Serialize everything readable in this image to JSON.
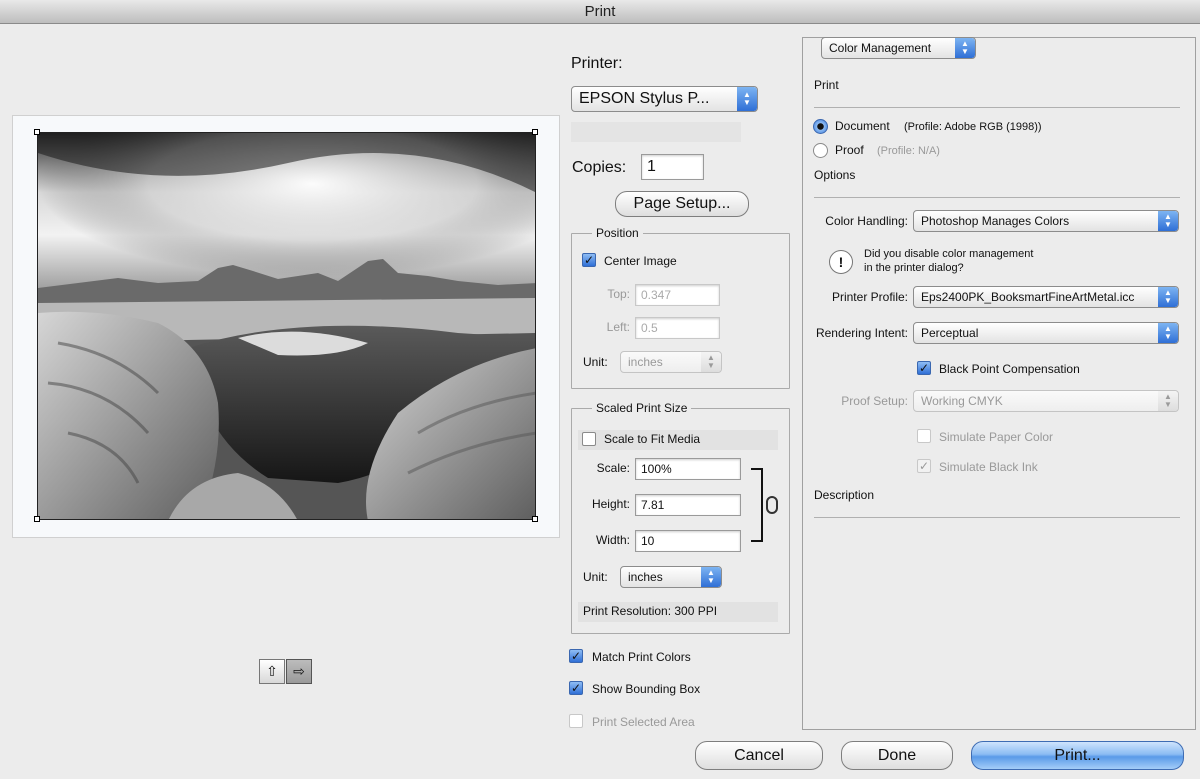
{
  "window": {
    "title": "Print"
  },
  "printer": {
    "label": "Printer:",
    "selected": "EPSON Stylus P...",
    "copies_label": "Copies:",
    "copies_value": "1",
    "page_setup_label": "Page Setup..."
  },
  "position": {
    "group_label": "Position",
    "center_image_label": "Center Image",
    "center_image_checked": true,
    "top_label": "Top:",
    "top_value": "0.347",
    "left_label": "Left:",
    "left_value": "0.5",
    "unit_label": "Unit:",
    "unit_value": "inches"
  },
  "scaled": {
    "group_label": "Scaled Print Size",
    "scale_to_fit_label": "Scale to Fit Media",
    "scale_label": "Scale:",
    "scale_value": "100%",
    "height_label": "Height:",
    "height_value": "7.81",
    "width_label": "Width:",
    "width_value": "10",
    "unit_label": "Unit:",
    "unit_value": "inches",
    "resolution": "Print Resolution: 300 PPI"
  },
  "options_bottom": {
    "match_print_colors": "Match Print Colors",
    "show_bounding_box": "Show Bounding Box",
    "print_selected_area": "Print Selected Area"
  },
  "color_mgmt": {
    "section_selector": "Color Management",
    "print_header": "Print",
    "document_label": "Document",
    "document_profile": "(Profile: Adobe RGB (1998))",
    "proof_label": "Proof",
    "proof_profile": "(Profile: N/A)",
    "options_header": "Options",
    "color_handling_label": "Color Handling:",
    "color_handling_value": "Photoshop Manages Colors",
    "warning_text_line1": "Did you disable color management",
    "warning_text_line2": "in the printer dialog?",
    "printer_profile_label": "Printer Profile:",
    "printer_profile_value": "Eps2400PK_BooksmartFineArtMetal.icc",
    "rendering_intent_label": "Rendering Intent:",
    "rendering_intent_value": "Perceptual",
    "black_point_label": "Black Point Compensation",
    "proof_setup_label": "Proof Setup:",
    "proof_setup_value": "Working CMYK",
    "simulate_paper_label": "Simulate Paper Color",
    "simulate_ink_label": "Simulate Black Ink",
    "description_header": "Description"
  },
  "buttons": {
    "cancel": "Cancel",
    "done": "Done",
    "print": "Print..."
  },
  "icons": {
    "portrait": "portrait-orientation-icon",
    "landscape": "landscape-orientation-icon",
    "warning": "exclamation-icon",
    "link": "chain-link-icon"
  }
}
